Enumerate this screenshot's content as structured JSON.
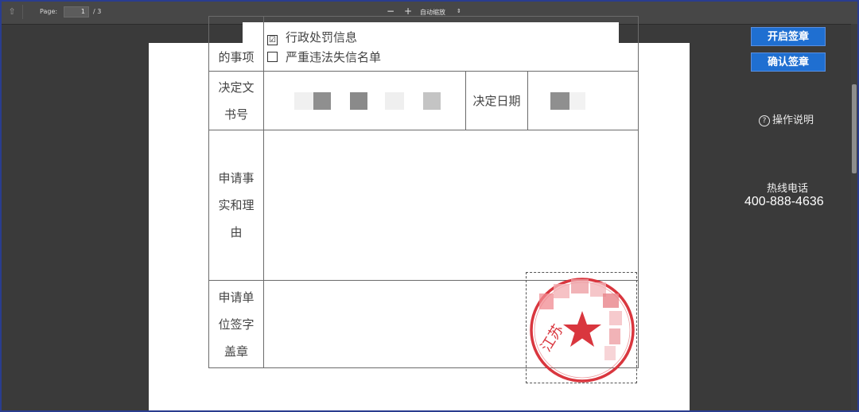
{
  "toolbar": {
    "page_label": "Page:",
    "page_value": "1",
    "page_total": "/ 3",
    "zoom_out": "−",
    "zoom_in": "+",
    "zoom_mode": "自动缩放",
    "zoom_caret": "⇕"
  },
  "form": {
    "item_label_tail": "的事项",
    "options": [
      {
        "label": "行政处罚信息",
        "checked": true,
        "mark": "☑"
      },
      {
        "label": "严重违法失信名单",
        "checked": false,
        "mark": ""
      }
    ],
    "decision_no_label": [
      "决定文",
      "书号"
    ],
    "decision_date_label": "决定日期",
    "reason_label": [
      "申请事",
      "实和理",
      "由"
    ],
    "sign_label": [
      "申请单",
      "位签字",
      "盖章"
    ]
  },
  "seal": {
    "text_left": "江苏",
    "color": "#d9363e"
  },
  "right_panel": {
    "open_sign_button": "开启签章",
    "confirm_sign_button": "确认签章",
    "help_icon": "?",
    "help_text": "操作说明",
    "hotline_label": "热线电话",
    "hotline_number": "400-888-4636"
  }
}
